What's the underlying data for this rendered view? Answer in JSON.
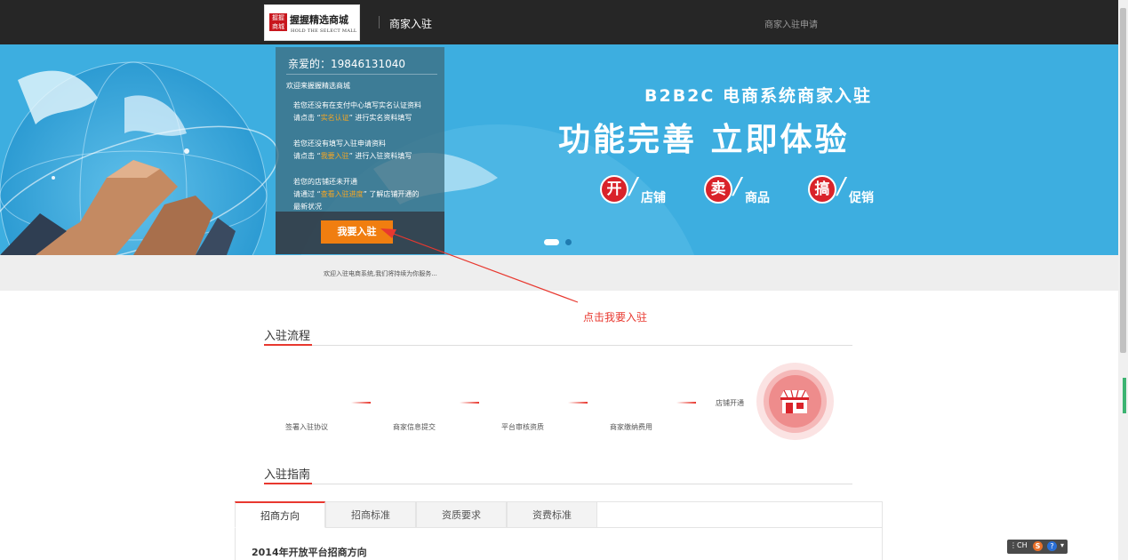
{
  "header": {
    "logo_name": "握握精选商城",
    "logo_sub": "HOLD THE SELECT MALL",
    "logo_mark": "握握商城",
    "title": "商家入驻",
    "apply_link": "商家入驻申请"
  },
  "panel": {
    "greeting": "亲爱的：19846131040",
    "welcome": "欢迎来握握精选商城",
    "line1a": "若您还没有在支付中心填写实名认证资料",
    "line1b_pre": "请点击 “",
    "line1b_hl": "实名认证",
    "line1b_post": "” 进行实名资料填写",
    "line2a": "若您还没有填写入驻申请资料",
    "line2b_pre": "请点击 “",
    "line2b_hl": "我要入驻",
    "line2b_post": "” 进行入驻资料填写",
    "line3a": "若您的店铺还未开通",
    "line3b_pre": "请通过 “",
    "line3b_hl": "查看入驻进度",
    "line3b_post": "” 了解店铺开通的",
    "line3c": "最新状况",
    "join_button": "我要入驻"
  },
  "banner": {
    "subtitle": "B2B2C 电商系统商家入驻",
    "headline": "功能完善 立即体验",
    "features": [
      {
        "char": "开",
        "label": "店铺"
      },
      {
        "char": "卖",
        "label": "商品"
      },
      {
        "char": "搞",
        "label": "促销"
      }
    ]
  },
  "strip_text": "欢迎入驻电商系统,我们将持续为你服务...",
  "annotation": "点击我要入驻",
  "process": {
    "title": "入驻流程",
    "steps": [
      "签署入驻协议",
      "商家信息提交",
      "平台审核资质",
      "商家缴纳费用",
      "店铺开通"
    ]
  },
  "guide": {
    "title": "入驻指南",
    "tabs": [
      "招商方向",
      "招商标准",
      "资质要求",
      "资费标准"
    ],
    "content_heading": "2014年开放平台招商方向"
  },
  "ime": {
    "label": "CH"
  },
  "colors": {
    "accent": "#e8382f",
    "banner": "#3daee0",
    "button": "#f07e10",
    "header": "#262626"
  }
}
